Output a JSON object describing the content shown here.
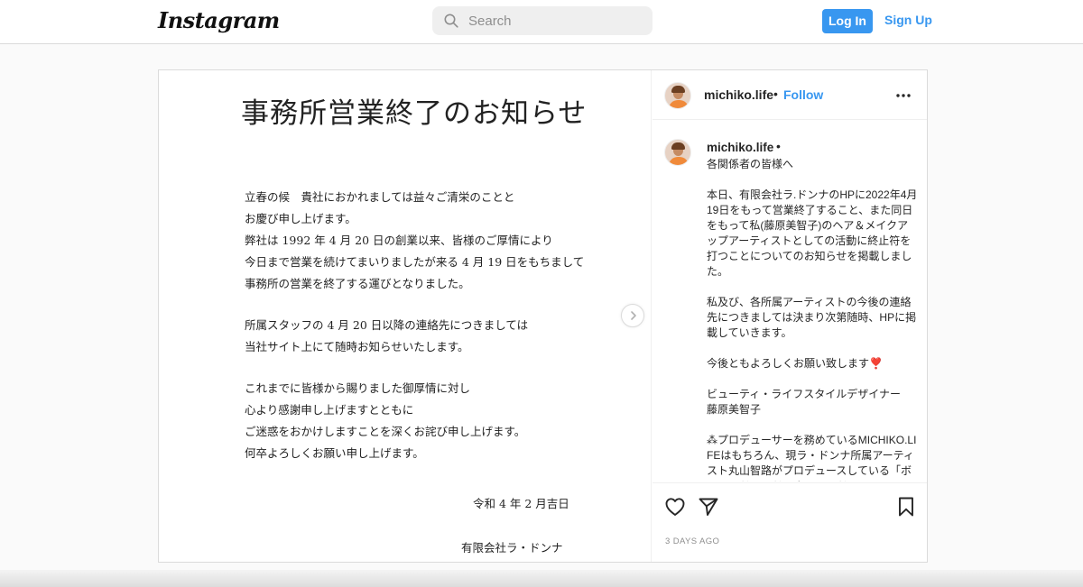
{
  "header": {
    "logo_text": "Instagram",
    "search_placeholder": "Search",
    "login_label": "Log In",
    "signup_label": "Sign Up"
  },
  "post": {
    "image": {
      "title": "事務所営業終了のお知らせ",
      "body_lines": [
        "立春の候　貴社におかれましては益々ご清栄のことと",
        "お慶び申し上げます。",
        "弊社は 1992 年 4 月 20 日の創業以来、皆様のご厚情により",
        "今日まで営業を続けてまいりましたが来る 4 月 19 日をもちまして",
        "事務所の営業を終了する運びとなりました。",
        "",
        "所属スタッフの 4 月 20 日以降の連絡先につきましては",
        "当社サイト上にて随時お知らせいたします。",
        "",
        "これまでに皆様から賜りました御厚情に対し",
        "心より感謝申し上げますとともに",
        "ご迷惑をおかけしますことを深くお詫び申し上げます。",
        "何卒よろしくお願い申し上げます。"
      ],
      "date": "令和 4 年 2 月吉日",
      "company": "有限会社ラ・ドンナ"
    },
    "header": {
      "username": "michiko.life",
      "separator": "•",
      "follow_label": "Follow",
      "more_icon": "more-horizontal-icon"
    },
    "caption": {
      "username": "michiko.life",
      "separator": "•",
      "text": "各関係者の皆様へ\n\n本日、有限会社ラ.ドンナのHPに2022年4月19日をもって営業終了すること、また同日をもって私(藤原美智子)のヘア＆メイクアップアーティストとしての活動に終止符を打つことについてのお知らせを掲載しました。\n\n私及び、各所属アーティストの今後の連絡先につきましては決まり次第随時、HPに掲載していきます。\n\n今後ともよろしくお願い致します❣️\n\nビューティ・ライフスタイルデザイナー\n藤原美智子\n\n⁂プロデューサーを務めているMICHIKO.LIFEはもちろん、現ラ・ドンナ所属アーティスト丸山智路がプロデュースしている「ボーテ・ド・ラドンナ」のアド"
    },
    "actions": {
      "like_icon": "heart-icon",
      "share_icon": "paper-plane-icon",
      "save_icon": "bookmark-icon"
    },
    "timestamp": "3 DAYS AGO"
  },
  "colors": {
    "accent": "#3897f0",
    "border": "#dbdbdb",
    "background": "#fafafa"
  }
}
